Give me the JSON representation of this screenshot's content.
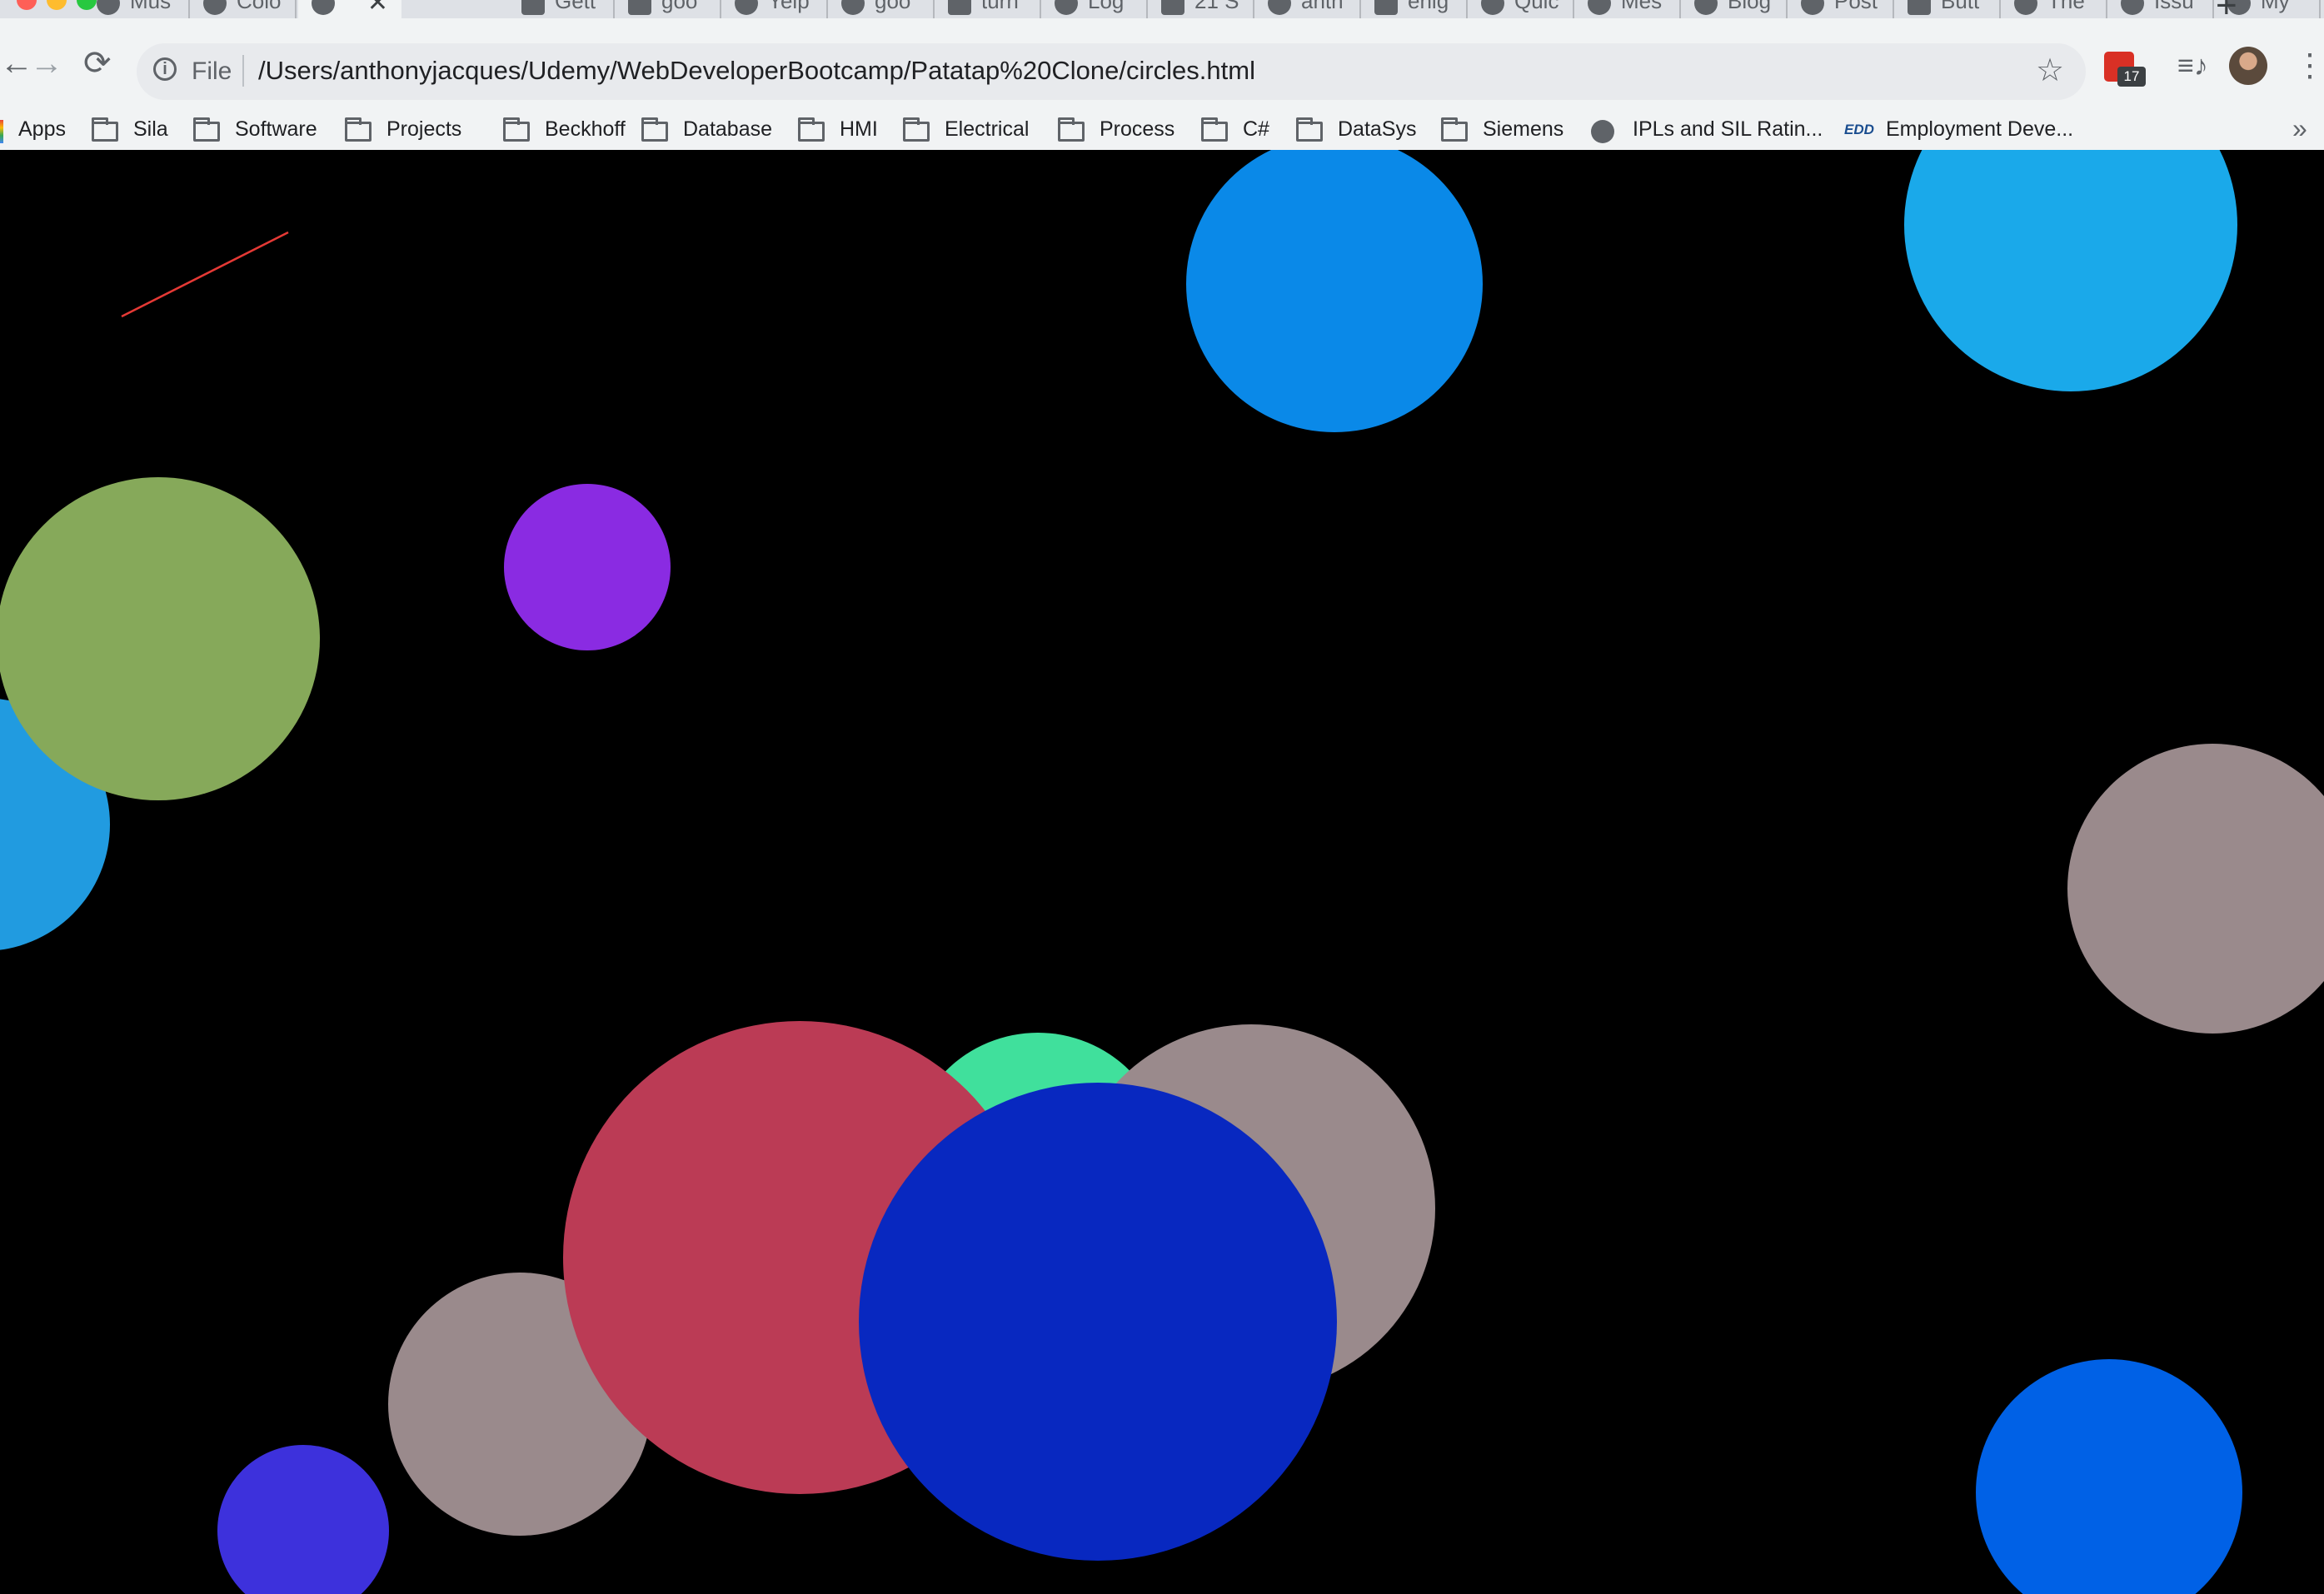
{
  "tabs": [
    {
      "label": "Mus",
      "icon": "globe-icon"
    },
    {
      "label": "Colo",
      "icon": "globe-icon"
    },
    {
      "label": "",
      "icon": "globe-icon",
      "active": true,
      "close": "✕"
    },
    {
      "label": "Gett",
      "icon": "db-logo-icon"
    },
    {
      "label": "goo",
      "icon": "terminal-icon"
    },
    {
      "label": "Yelp",
      "icon": "globe-icon"
    },
    {
      "label": "goo",
      "icon": "globe-icon"
    },
    {
      "label": "turn",
      "icon": "square-logo-icon"
    },
    {
      "label": "Log",
      "icon": "leaf-icon"
    },
    {
      "label": "21 S",
      "icon": "book-icon"
    },
    {
      "label": "anth",
      "icon": "github-icon"
    },
    {
      "label": "enig",
      "icon": "h-logo-icon"
    },
    {
      "label": "Quic",
      "icon": "moon-icon"
    },
    {
      "label": "Mes",
      "icon": "moon-icon"
    },
    {
      "label": "Blog",
      "icon": "moon-icon"
    },
    {
      "label": "Post",
      "icon": "globe-icon"
    },
    {
      "label": "Butt",
      "icon": "bootstrap-icon"
    },
    {
      "label": "The",
      "icon": "python-icon"
    },
    {
      "label": "Issu",
      "icon": "github-icon"
    },
    {
      "label": "My",
      "icon": "drive-icon"
    }
  ],
  "new_tab": "+",
  "toolbar": {
    "back": "←",
    "forward": "→",
    "reload": "⟳",
    "info": "i",
    "scheme": "File",
    "url": "/Users/anthonyjacques/Udemy/WebDeveloperBootcamp/Patatap%20Clone/circles.html",
    "star": "☆",
    "ext_badge": "17",
    "media": "≡♪",
    "menu": "⋮"
  },
  "bookmarks": [
    {
      "label": "Apps",
      "icon": "apps-icon"
    },
    {
      "label": "Sila",
      "icon": "folder-icon"
    },
    {
      "label": "Software",
      "icon": "folder-icon"
    },
    {
      "label": "Projects",
      "icon": "folder-icon"
    },
    {
      "label": "Beckhoff",
      "icon": "folder-icon"
    },
    {
      "label": "Database",
      "icon": "folder-icon"
    },
    {
      "label": "HMI",
      "icon": "folder-icon"
    },
    {
      "label": "Electrical",
      "icon": "folder-icon"
    },
    {
      "label": "Process",
      "icon": "folder-icon"
    },
    {
      "label": "C#",
      "icon": "folder-icon"
    },
    {
      "label": "DataSys",
      "icon": "folder-icon"
    },
    {
      "label": "Siemens",
      "icon": "folder-icon"
    },
    {
      "label": "IPLs and SIL Ratin...",
      "icon": "globe-icon"
    },
    {
      "label": "Employment Deve...",
      "icon": "edd-icon",
      "icon_text": "EDD"
    }
  ],
  "bookmarks_more": "»",
  "canvas": {
    "background": "#000000",
    "line_color": "#e53935",
    "circle_colors": [
      "#0a89e8",
      "#1aa9ea",
      "#86a95a",
      "#8a2be2",
      "#219be0",
      "#9a8a8c",
      "#bb3b55",
      "#40e09c",
      "#0828c0",
      "#3d31dc",
      "#0061e6",
      "#2f4ee8"
    ]
  }
}
